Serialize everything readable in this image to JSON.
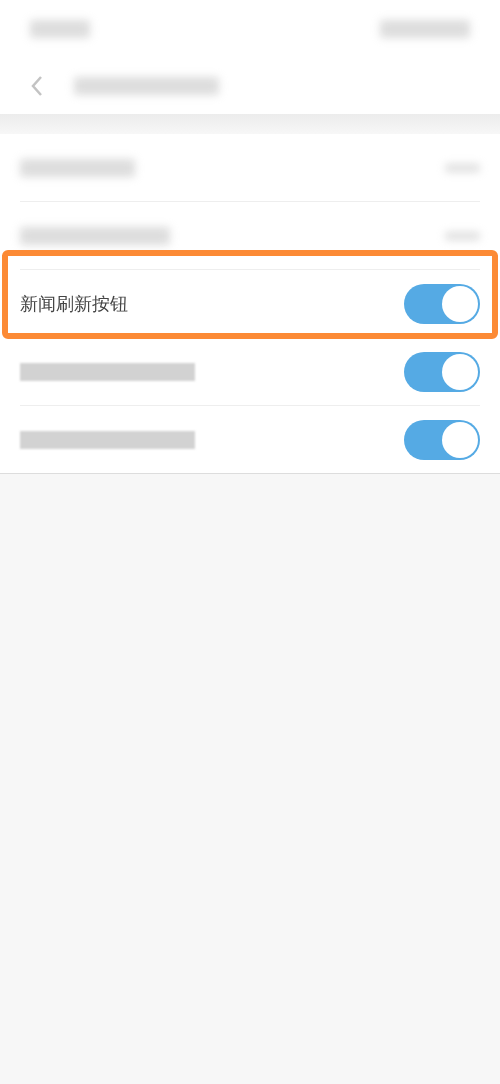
{
  "rows": [
    {
      "kind": "value"
    },
    {
      "kind": "value"
    },
    {
      "kind": "toggle",
      "label": "新闻刷新按钮",
      "on": true,
      "highlighted": true
    },
    {
      "kind": "toggle",
      "on": true
    },
    {
      "kind": "toggle",
      "on": true
    }
  ]
}
